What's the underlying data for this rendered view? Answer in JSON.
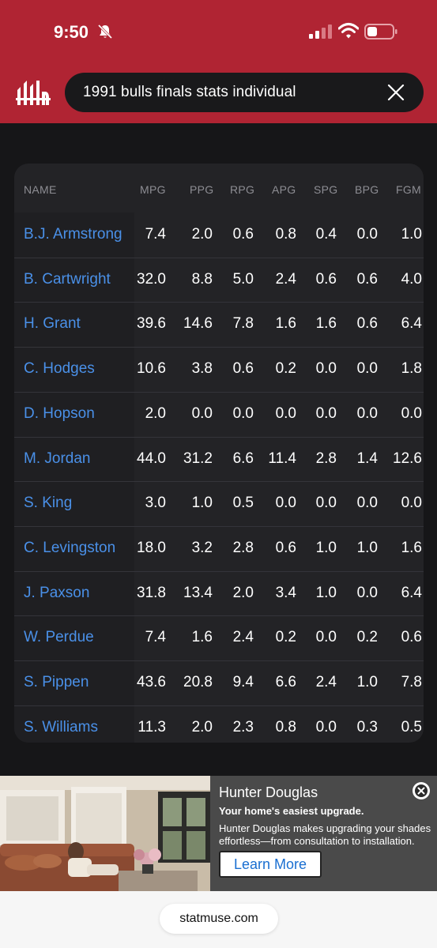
{
  "status_bar": {
    "time": "9:50"
  },
  "search": {
    "query": "1991 bulls finals stats individual"
  },
  "table": {
    "headers": [
      "NAME",
      "MPG",
      "PPG",
      "RPG",
      "APG",
      "SPG",
      "BPG",
      "FGM"
    ],
    "rows": [
      {
        "name": "B.J. Armstrong",
        "values": [
          "7.4",
          "2.0",
          "0.6",
          "0.8",
          "0.4",
          "0.0",
          "1.0"
        ]
      },
      {
        "name": "B. Cartwright",
        "values": [
          "32.0",
          "8.8",
          "5.0",
          "2.4",
          "0.6",
          "0.6",
          "4.0"
        ]
      },
      {
        "name": "H. Grant",
        "values": [
          "39.6",
          "14.6",
          "7.8",
          "1.6",
          "1.6",
          "0.6",
          "6.4"
        ]
      },
      {
        "name": "C. Hodges",
        "values": [
          "10.6",
          "3.8",
          "0.6",
          "0.2",
          "0.0",
          "0.0",
          "1.8"
        ]
      },
      {
        "name": "D. Hopson",
        "values": [
          "2.0",
          "0.0",
          "0.0",
          "0.0",
          "0.0",
          "0.0",
          "0.0"
        ]
      },
      {
        "name": "M. Jordan",
        "values": [
          "44.0",
          "31.2",
          "6.6",
          "11.4",
          "2.8",
          "1.4",
          "12.6"
        ]
      },
      {
        "name": "S. King",
        "values": [
          "3.0",
          "1.0",
          "0.5",
          "0.0",
          "0.0",
          "0.0",
          "0.0"
        ]
      },
      {
        "name": "C. Levingston",
        "values": [
          "18.0",
          "3.2",
          "2.8",
          "0.6",
          "1.0",
          "1.0",
          "1.6"
        ]
      },
      {
        "name": "J. Paxson",
        "values": [
          "31.8",
          "13.4",
          "2.0",
          "3.4",
          "1.0",
          "0.0",
          "6.4"
        ]
      },
      {
        "name": "W. Perdue",
        "values": [
          "7.4",
          "1.6",
          "2.4",
          "0.2",
          "0.0",
          "0.2",
          "0.6"
        ]
      },
      {
        "name": "S. Pippen",
        "values": [
          "43.6",
          "20.8",
          "9.4",
          "6.6",
          "2.4",
          "1.0",
          "7.8"
        ]
      },
      {
        "name": "S. Williams",
        "values": [
          "11.3",
          "2.0",
          "2.3",
          "0.8",
          "0.0",
          "0.3",
          "0.5"
        ]
      }
    ]
  },
  "ad": {
    "brand": "Hunter Douglas",
    "tagline": "Your home's easiest upgrade.",
    "body": "Hunter Douglas makes upgrading your shades effortless—from consultation to installation.",
    "cta": "Learn More"
  },
  "footer": {
    "url": "statmuse.com"
  },
  "colors": {
    "header_red": "#b02433",
    "link_blue": "#4a90e8",
    "background": "#161618",
    "card": "#232326"
  },
  "icons": [
    "statmuse-logo-icon",
    "bell-slash-icon",
    "signal-icon",
    "wifi-icon",
    "battery-icon",
    "close-icon",
    "ad-close-icon"
  ]
}
